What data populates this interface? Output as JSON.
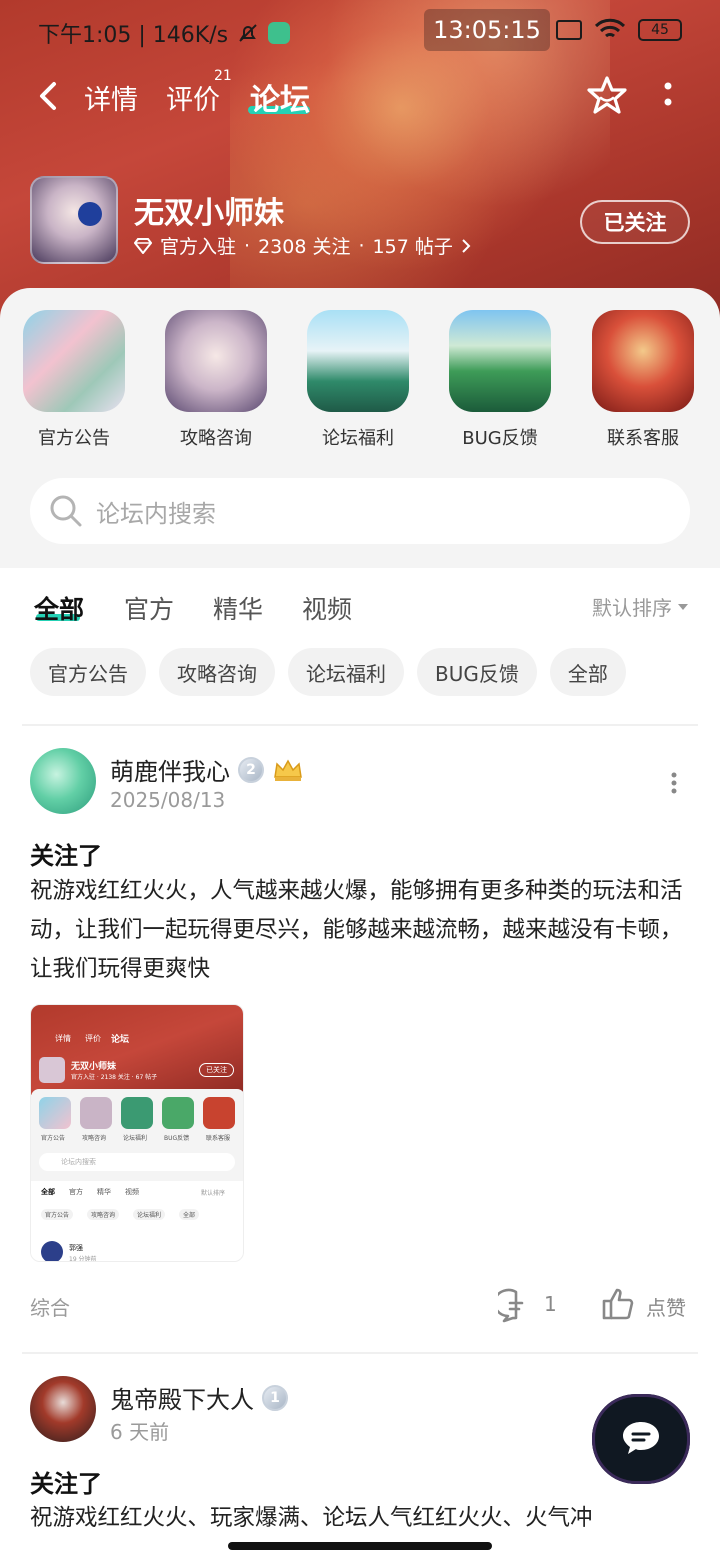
{
  "status_bar": {
    "left_text": "下午1:05 | 146K/s",
    "clock": "13:05:15",
    "battery": "45"
  },
  "nav": {
    "tabs": [
      {
        "label": "详情"
      },
      {
        "label": "评价",
        "badge": "21"
      },
      {
        "label": "论坛"
      }
    ]
  },
  "forum": {
    "name": "无双小师妹",
    "verified": "官方入驻",
    "follows": "2308 关注",
    "posts": "157 帖子",
    "follow_button": "已关注"
  },
  "shortcuts": [
    {
      "label": "官方公告",
      "icon": "announcement-art"
    },
    {
      "label": "攻略咨询",
      "icon": "guide-art"
    },
    {
      "label": "论坛福利",
      "icon": "welfare-art"
    },
    {
      "label": "BUG反馈",
      "icon": "bug-art"
    },
    {
      "label": "联系客服",
      "icon": "service-art"
    }
  ],
  "search": {
    "placeholder": "论坛内搜索"
  },
  "tabs": [
    {
      "label": "全部"
    },
    {
      "label": "官方"
    },
    {
      "label": "精华"
    },
    {
      "label": "视频"
    }
  ],
  "sort_label": "默认排序",
  "chips": [
    "官方公告",
    "攻略咨询",
    "论坛福利",
    "BUG反馈",
    "全部"
  ],
  "posts": [
    {
      "user": "萌鹿伴我心",
      "level": "2",
      "date": "2025/08/13",
      "title": "关注了",
      "body": "祝游戏红红火火，人气越来越火爆，能够拥有更多种类的玩法和活动，让我们一起玩得更尽兴，能够越来越流畅，越来越没有卡顿，让我们玩得更爽快",
      "category": "综合",
      "comments": "1",
      "like_label": "点赞",
      "thumbnail": {
        "nav_tabs": [
          "详情",
          "评价",
          "论坛"
        ],
        "name": "无双小师妹",
        "meta": "官方入驻 · 2138 关注 · 67 帖子",
        "follow": "已关注",
        "shortcuts": [
          "官方公告",
          "攻略咨询",
          "论坛福利",
          "BUG反馈",
          "联系客服"
        ],
        "search": "论坛内搜索",
        "tabs": [
          "全部",
          "官方",
          "精华",
          "视频"
        ],
        "sort": "默认排序",
        "chips": [
          "官方公告",
          "攻略咨询",
          "论坛福利",
          "全部"
        ],
        "user": "郭强",
        "time": "19 分钟前"
      }
    },
    {
      "user": "鬼帝殿下大人",
      "level": "1",
      "date": "6 天前",
      "title": "关注了",
      "body": "祝游戏红红火火、玩家爆满、论坛人气红红火火、火气冲"
    }
  ],
  "colors": {
    "accent": "#25d1b5",
    "banner": "#b23a2c"
  }
}
